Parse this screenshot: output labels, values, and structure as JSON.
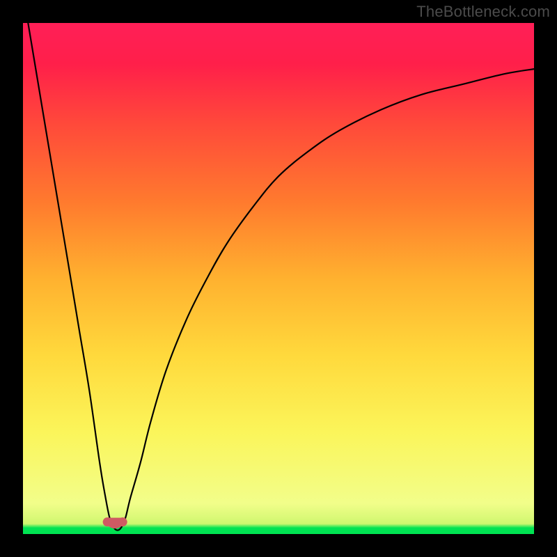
{
  "watermark": "TheBottleneck.com",
  "chart_data": {
    "type": "line",
    "title": "",
    "xlabel": "",
    "ylabel": "",
    "xlim": [
      0,
      100
    ],
    "ylim": [
      0,
      100
    ],
    "valley_x": 18,
    "series": [
      {
        "name": "curve",
        "x": [
          1,
          3,
          5,
          7,
          9,
          11,
          13,
          15,
          16,
          17,
          18,
          19,
          20,
          21,
          23,
          25,
          28,
          32,
          36,
          40,
          45,
          50,
          56,
          62,
          70,
          78,
          86,
          94,
          100
        ],
        "values": [
          100,
          88,
          76,
          64,
          52,
          40,
          28,
          14,
          8,
          3,
          1,
          1,
          3,
          7,
          14,
          22,
          32,
          42,
          50,
          57,
          64,
          70,
          75,
          79,
          83,
          86,
          88,
          90,
          91
        ]
      }
    ],
    "marker": {
      "name": "valley-marker",
      "x_range": [
        16.5,
        19.5
      ],
      "y": 1,
      "color": "#cf5a63"
    }
  }
}
